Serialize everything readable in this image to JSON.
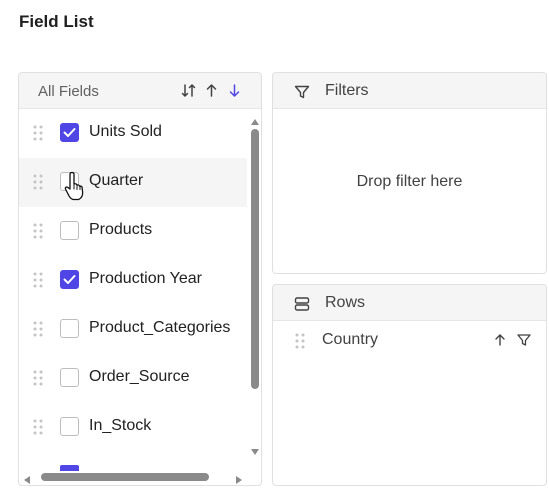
{
  "title": "Field List",
  "fields_panel": {
    "header_label": "All Fields",
    "sort_icons": [
      "sort-toggle-icon",
      "sort-ascending-icon",
      "sort-descending-icon"
    ],
    "items": [
      {
        "label": "Units Sold",
        "checked": true
      },
      {
        "label": "Quarter",
        "checked": false
      },
      {
        "label": "Products",
        "checked": false
      },
      {
        "label": "Production Year",
        "checked": true
      },
      {
        "label": "Product_Categories",
        "checked": false
      },
      {
        "label": "Order_Source",
        "checked": false
      },
      {
        "label": "In_Stock",
        "checked": false
      }
    ]
  },
  "filters": {
    "label": "Filters",
    "placeholder": "Drop filter here",
    "icon": "filter-icon"
  },
  "rows": {
    "label": "Rows",
    "icon": "rows-icon",
    "items": [
      {
        "label": "Country"
      }
    ]
  },
  "colors": {
    "accent": "#4f46e5",
    "header_bg": "#f5f5f5",
    "border": "#e0e0e0"
  }
}
